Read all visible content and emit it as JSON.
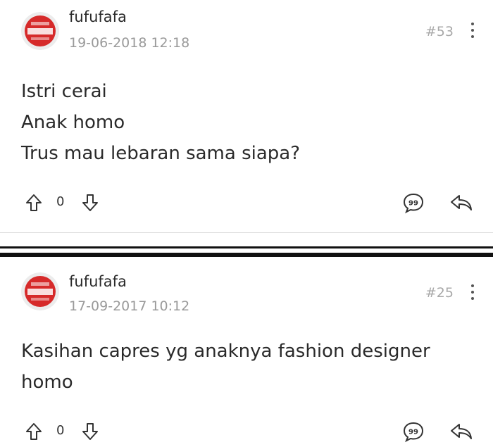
{
  "posts": [
    {
      "username": "fufufafa",
      "timestamp": "19-06-2018 12:18",
      "post_number": "#53",
      "lines": [
        "Istri cerai",
        "Anak homo",
        "Trus mau lebaran sama siapa?"
      ],
      "vote_count": "0"
    },
    {
      "username": "fufufafa",
      "timestamp": "17-09-2017 10:12",
      "post_number": "#25",
      "lines": [
        "Kasihan capres yg anaknya fashion designer",
        "homo"
      ],
      "vote_count": "0"
    }
  ],
  "icons": {
    "avatar": "red-badge-logo",
    "more": "kebab-menu-icon",
    "upvote": "arrow-up-icon",
    "downvote": "arrow-down-icon",
    "quote": "quote-bubble-icon",
    "reply": "reply-arrow-icon"
  },
  "colors": {
    "avatar_red": "#d62a2a",
    "timestamp_gray": "#9a9a9a",
    "divider": "#111111"
  }
}
